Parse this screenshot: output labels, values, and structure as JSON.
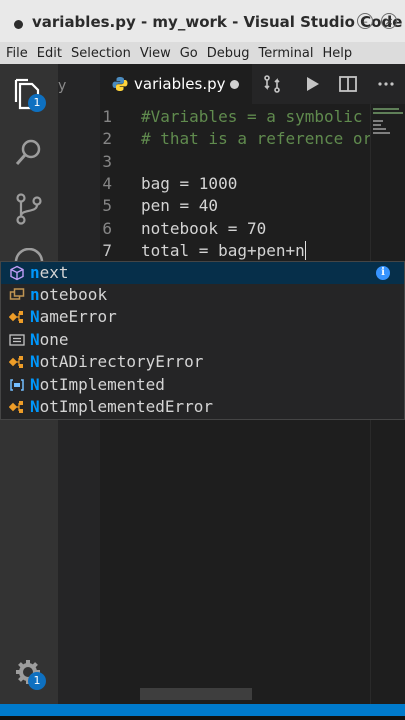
{
  "window": {
    "title": "variables.py - my_work - Visual Studio Code",
    "minimize_glyph": "–",
    "close_glyph": "×"
  },
  "menu": [
    "File",
    "Edit",
    "Selection",
    "View",
    "Go",
    "Debug",
    "Terminal",
    "Help"
  ],
  "activity_bar": {
    "icons": [
      "files-icon",
      "search-icon",
      "source-control-icon",
      "extensions-icon",
      "settings-gear-icon"
    ],
    "explorer_badge": "1",
    "settings_badge": "1"
  },
  "sidebar": {
    "partial_text": "y"
  },
  "tab": {
    "label": "variables.py",
    "dirty": true
  },
  "editor": {
    "line_numbers": [
      "1",
      "2",
      "3",
      "4",
      "5",
      "6",
      "7"
    ],
    "lines": [
      "#Variables = a symbolic name",
      "# that is a reference or pointer",
      "",
      "bag = 1000",
      "pen = 40",
      "notebook = 70",
      "total = bag+pen+n"
    ],
    "active_line": 7
  },
  "suggestions": {
    "typed": "n",
    "items": [
      {
        "match": "n",
        "rest": "ext",
        "kind": "keyword",
        "selected": true
      },
      {
        "match": "n",
        "rest": "otebook",
        "kind": "variable",
        "selected": false
      },
      {
        "match": "N",
        "rest": "ameError",
        "kind": "class",
        "selected": false
      },
      {
        "match": "N",
        "rest": "one",
        "kind": "constant",
        "selected": false
      },
      {
        "match": "N",
        "rest": "otADirectoryError",
        "kind": "class",
        "selected": false
      },
      {
        "match": "N",
        "rest": "otImplemented",
        "kind": "enum",
        "selected": false
      },
      {
        "match": "N",
        "rest": "otImplementedError",
        "kind": "class",
        "selected": false
      }
    ],
    "info_glyph": "i"
  },
  "colors": {
    "accent": "#007acc",
    "match_highlight": "#0097fb",
    "comment": "#608b4e",
    "selected_row": "#062f4a"
  }
}
